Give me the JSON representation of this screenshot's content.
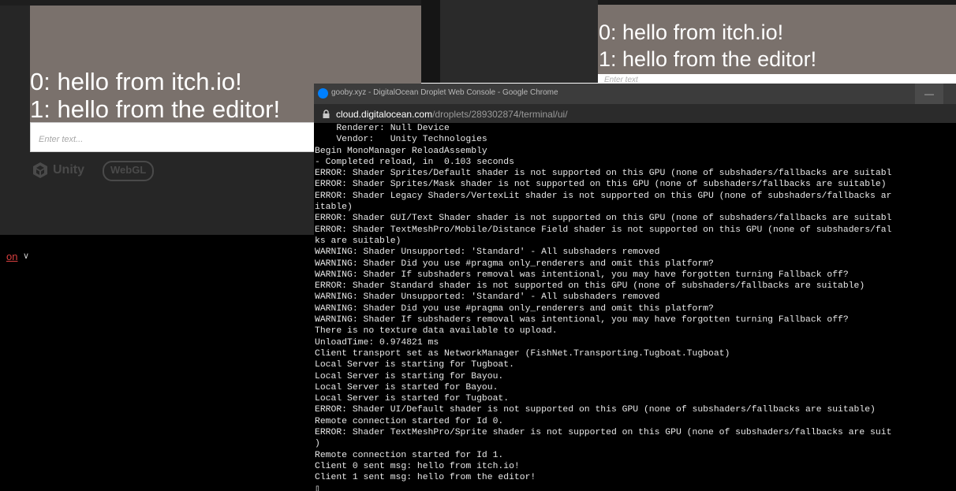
{
  "left_game": {
    "message_lines": [
      "0: hello from itch.io!",
      "1: hello from the editor!"
    ],
    "input_placeholder": "Enter text...",
    "unity_label": "Unity",
    "webgl_label": "WebGL"
  },
  "left_footer": {
    "link_fragment": "on",
    "chevron": "∨"
  },
  "right_game": {
    "message_lines": [
      "0: hello from itch.io!",
      "1: hello from the editor!"
    ],
    "input_placeholder": "Enter text"
  },
  "chrome": {
    "title": "gooby.xyz - DigitalOcean Droplet Web Console - Google Chrome",
    "minimize_glyph": "—",
    "url_host": "cloud.digitalocean.com",
    "url_path": "/droplets/289302874/terminal/ui/"
  },
  "terminal": {
    "lines": [
      "    Renderer: Null Device",
      "    Vendor:   Unity Technologies",
      "Begin MonoManager ReloadAssembly",
      "- Completed reload, in  0.103 seconds",
      "ERROR: Shader Sprites/Default shader is not supported on this GPU (none of subshaders/fallbacks are suitabl",
      "ERROR: Shader Sprites/Mask shader is not supported on this GPU (none of subshaders/fallbacks are suitable)",
      "ERROR: Shader Legacy Shaders/VertexLit shader is not supported on this GPU (none of subshaders/fallbacks ar",
      "itable)",
      "ERROR: Shader GUI/Text Shader shader is not supported on this GPU (none of subshaders/fallbacks are suitabl",
      "ERROR: Shader TextMeshPro/Mobile/Distance Field shader is not supported on this GPU (none of subshaders/fal",
      "ks are suitable)",
      "WARNING: Shader Unsupported: 'Standard' - All subshaders removed",
      "WARNING: Shader Did you use #pragma only_renderers and omit this platform?",
      "WARNING: Shader If subshaders removal was intentional, you may have forgotten turning Fallback off?",
      "ERROR: Shader Standard shader is not supported on this GPU (none of subshaders/fallbacks are suitable)",
      "WARNING: Shader Unsupported: 'Standard' - All subshaders removed",
      "WARNING: Shader Did you use #pragma only_renderers and omit this platform?",
      "WARNING: Shader If subshaders removal was intentional, you may have forgotten turning Fallback off?",
      "There is no texture data available to upload.",
      "UnloadTime: 0.974821 ms",
      "Client transport set as NetworkManager (FishNet.Transporting.Tugboat.Tugboat)",
      "Local Server is starting for Tugboat.",
      "Local Server is starting for Bayou.",
      "Local Server is started for Bayou.",
      "Local Server is started for Tugboat.",
      "ERROR: Shader UI/Default shader is not supported on this GPU (none of subshaders/fallbacks are suitable)",
      "Remote connection started for Id 0.",
      "ERROR: Shader TextMeshPro/Sprite shader is not supported on this GPU (none of subshaders/fallbacks are suit",
      ")",
      "Remote connection started for Id 1.",
      "Client 0 sent msg: hello from itch.io!",
      "Client 1 sent msg: hello from the editor!",
      "▯"
    ]
  }
}
